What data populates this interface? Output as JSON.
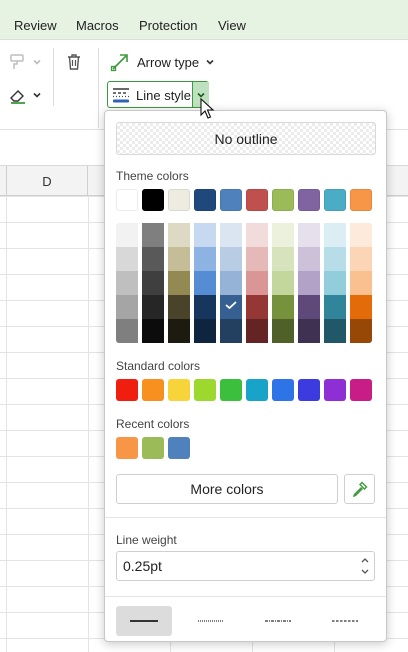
{
  "menubar": {
    "items": [
      "Review",
      "Macros",
      "Protection",
      "View"
    ]
  },
  "ribbon": {
    "arrow_type_label": "Arrow type",
    "line_style_label": "Line style"
  },
  "sheet": {
    "column_label": "D"
  },
  "popup": {
    "no_outline_label": "No outline",
    "theme_colors_title": "Theme colors",
    "theme_colors": [
      "#ffffff",
      "#000000",
      "#eeece1",
      "#1f497d",
      "#4f81bd",
      "#c0504d",
      "#9bbb59",
      "#8064a2",
      "#4bacc6",
      "#f79646"
    ],
    "theme_shades": [
      [
        "#f2f2f2",
        "#7f7f7f",
        "#ddd9c3",
        "#c6d9f0",
        "#dbe5f1",
        "#f2dcdb",
        "#ebf1dd",
        "#e5e0ec",
        "#dbeef3",
        "#fdeada"
      ],
      [
        "#d8d8d8",
        "#595959",
        "#c4bd97",
        "#8db3e2",
        "#b8cce4",
        "#e5b9b7",
        "#d7e3bc",
        "#ccc1d9",
        "#b7dde8",
        "#fbd5b5"
      ],
      [
        "#bfbfbf",
        "#3f3f3f",
        "#938953",
        "#548dd4",
        "#95b3d7",
        "#d99694",
        "#c3d69b",
        "#b2a2c7",
        "#92cddc",
        "#fac08f"
      ],
      [
        "#a5a5a5",
        "#262626",
        "#494429",
        "#17365d",
        "#366092",
        "#953734",
        "#76923c",
        "#5f497a",
        "#31859b",
        "#e36c09"
      ],
      [
        "#7f7f7f",
        "#0c0c0c",
        "#1d1b10",
        "#0f243e",
        "#244061",
        "#632423",
        "#4f6128",
        "#3f3151",
        "#205867",
        "#974806"
      ]
    ],
    "selected_shade": {
      "row": 3,
      "col": 4
    },
    "standard_colors_title": "Standard colors",
    "standard_colors": [
      "#f01e0f",
      "#f7901e",
      "#f7d53a",
      "#9cd82e",
      "#3cbf3c",
      "#1aa3c9",
      "#2f74e6",
      "#3b3be0",
      "#8d2fd4",
      "#c81d86"
    ],
    "recent_colors_title": "Recent colors",
    "recent_colors": [
      "#f79646",
      "#9bbb59",
      "#4f81bd"
    ],
    "more_colors_label": "More colors",
    "line_weight_title": "Line weight",
    "line_weight_value": "0.25pt",
    "line_styles": [
      "solid",
      "dotted",
      "dash-dot",
      "dashed"
    ],
    "selected_line_style": "solid"
  },
  "colors": {
    "menubar_bg": "#e6f2e2",
    "accent_green": "#3c9a3c",
    "check_white": "#ffffff"
  }
}
